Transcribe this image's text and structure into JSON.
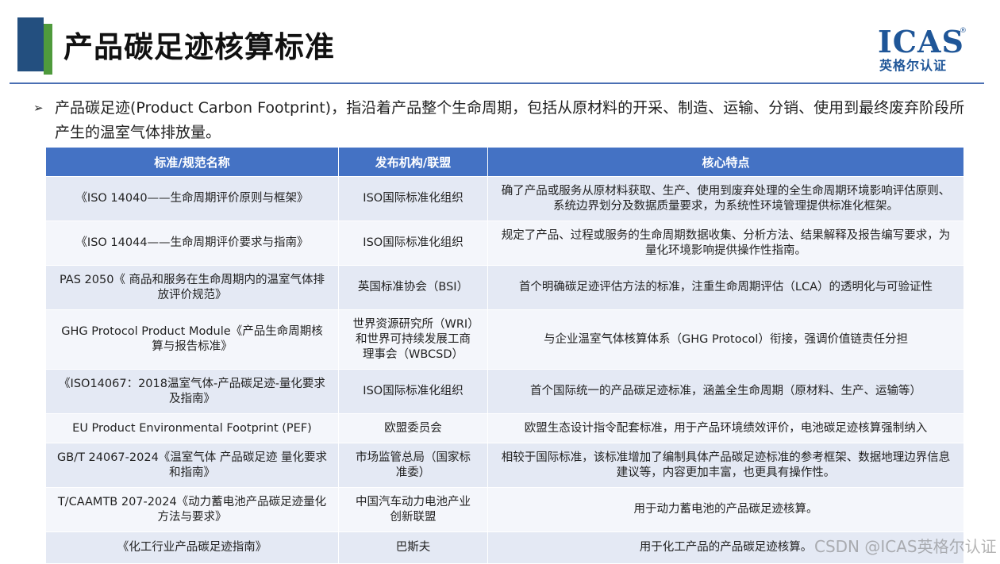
{
  "header": {
    "title": "产品碳足迹核算标准",
    "logo": {
      "name": "ICAS",
      "reg_mark": "®",
      "subtitle": "英格尔认证"
    }
  },
  "intro": {
    "bullet": "➢",
    "text": "产品碳足迹(Product Carbon  Footprint)，指沿着产品整个生命周期，包括从原材料的开采、制造、运输、分销、使用到最终废弃阶段所产生的温室气体排放量。"
  },
  "table": {
    "headers": [
      "标准/规范名称",
      "发布机构/联盟",
      "核心特点"
    ],
    "rows": [
      {
        "name": "《ISO 14040——生命周期评价原则与框架》",
        "org": "ISO国际标准化组织",
        "feature": "确了产品或服务从原材料获取、生产、使用到废弃处理的全生命周期环境影响评估原则、系统边界划分及数据质量要求，为系统性环境管理提供标准化框架。"
      },
      {
        "name": "《ISO 14044——生命周期评价要求与指南》",
        "org": "ISO国际标准化组织",
        "feature": "规定了产品、过程或服务的生命周期数据收集、分析方法、结果解释及报告编写要求，为量化环境影响提供操作性指南。"
      },
      {
        "name": "PAS 2050《 商品和服务在生命周期内的温室气体排放评价规范》",
        "org": "英国标准协会（BSI）",
        "feature": "首个明确碳足迹评估方法的标准，注重生命周期评估（LCA）的透明化与可验证性"
      },
      {
        "name": "GHG Protocol Product Module《产品生命周期核算与报告标准》",
        "org": "世界资源研究所（WRI）和世界可持续发展工商理事会（WBCSD）",
        "feature": "与企业温室气体核算体系（GHG Protocol）衔接，强调价值链责任分担"
      },
      {
        "name": "《ISO14067：2018温室气体-产品碳足迹-量化要求及指南》",
        "org": "ISO国际标准化组织",
        "feature": "首个国际统一的产品碳足迹标准，涵盖全生命周期（原材料、生产、运输等）"
      },
      {
        "name": "EU Product Environmental Footprint (PEF)",
        "org": "欧盟委员会",
        "feature": "欧盟生态设计指令配套标准，用于产品环境绩效评价，电池碳足迹核算强制纳入"
      },
      {
        "name": "GB/T 24067-2024《温室气体 产品碳足迹 量化要求和指南》",
        "org": "市场监管总局（国家标准委）",
        "feature": "相较于国际标准，该标准增加了编制具体产品碳足迹标准的参考框架、数据地理边界信息建议等，内容更加丰富，也更具有操作性。"
      },
      {
        "name": "T/CAAMTB 207-2024《动力蓄电池产品碳足迹量化方法与要求》",
        "org": "中国汽车动力电池产业创新联盟",
        "feature": "用于动力蓄电池的产品碳足迹核算。"
      },
      {
        "name": "《化工行业产品碳足迹指南》",
        "org": "巴斯夫",
        "feature": "用于化工产品的产品碳足迹核算。"
      }
    ]
  },
  "watermark": "CSDN @ICAS英格尔认证"
}
